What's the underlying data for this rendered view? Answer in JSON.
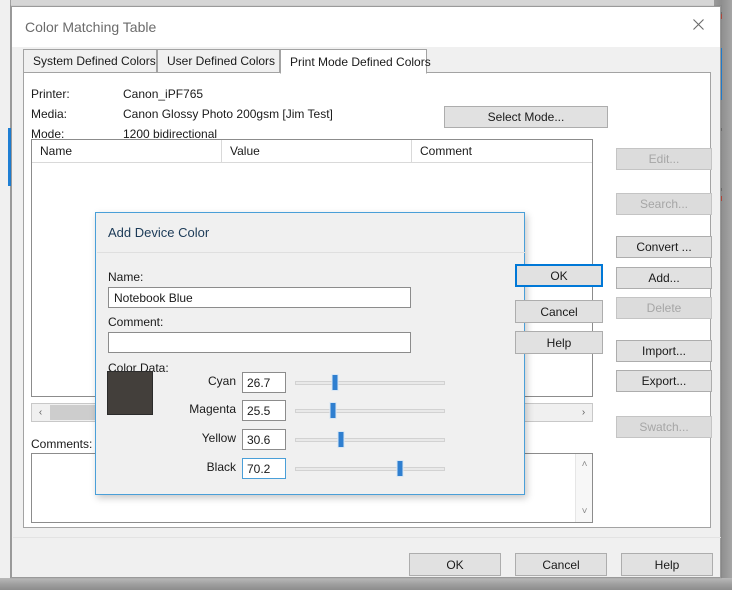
{
  "window": {
    "title": "Color Matching Table",
    "close_icon": "close-icon"
  },
  "tabs": [
    {
      "label": "System Defined Colors",
      "active": false
    },
    {
      "label": "User Defined Colors",
      "active": false
    },
    {
      "label": "Print Mode Defined Colors",
      "active": true
    }
  ],
  "printer_info": [
    {
      "label": "Printer:",
      "value": "Canon_iPF765"
    },
    {
      "label": "Media:",
      "value": "Canon Glossy Photo 200gsm [Jim Test]"
    },
    {
      "label": "Mode:",
      "value": "1200 bidirectional"
    }
  ],
  "select_mode_button": "Select Mode...",
  "list": {
    "columns": [
      "Name",
      "Value",
      "Comment"
    ],
    "rows": [],
    "hscroll": {
      "left_arrow": "‹",
      "right_arrow": "›"
    }
  },
  "comments": {
    "label": "Comments:",
    "value": "",
    "scroll_up": "˄",
    "scroll_down": "˅"
  },
  "side_buttons": [
    {
      "label": "Edit...",
      "enabled": false
    },
    {
      "label": "Search...",
      "enabled": false
    },
    {
      "label": "Convert ...",
      "enabled": true
    },
    {
      "label": "Add...",
      "enabled": true
    },
    {
      "label": "Delete",
      "enabled": false
    },
    {
      "label": "Import...",
      "enabled": true
    },
    {
      "label": "Export...",
      "enabled": true
    },
    {
      "label": "Swatch...",
      "enabled": false
    }
  ],
  "bottom_buttons": [
    {
      "label": "OK"
    },
    {
      "label": "Cancel"
    },
    {
      "label": "Help"
    }
  ],
  "dialog": {
    "title": "Add Device Color",
    "name_label": "Name:",
    "name_value": "Notebook Blue",
    "comment_label": "Comment:",
    "comment_value": "",
    "color_data_label": "Color Data:",
    "swatch_color": "#433F3B",
    "buttons": [
      {
        "label": "OK",
        "focused": true
      },
      {
        "label": "Cancel",
        "focused": false
      },
      {
        "label": "Help",
        "focused": false
      }
    ],
    "channels": [
      {
        "name": "Cyan",
        "value": "26.7",
        "percent": 26.7,
        "focused": false
      },
      {
        "name": "Magenta",
        "value": "25.5",
        "percent": 25.5,
        "focused": false
      },
      {
        "name": "Yellow",
        "value": "30.6",
        "percent": 30.6,
        "focused": false
      },
      {
        "name": "Black",
        "value": "70.2",
        "percent": 70.2,
        "focused": true
      }
    ]
  },
  "background": {
    "obscured_text": "Canon iPF765"
  }
}
